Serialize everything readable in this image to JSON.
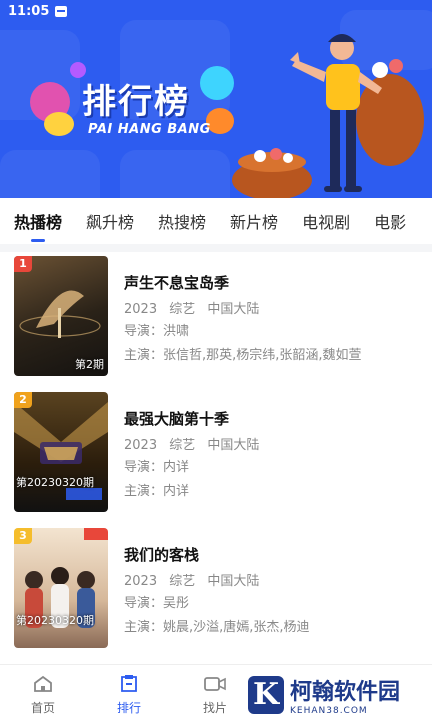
{
  "status_bar": {
    "time": "11:05"
  },
  "banner": {
    "title": "排行榜",
    "subtitle": "PAI HANG BANG",
    "background_color": "#2d5cf0"
  },
  "tabs": [
    {
      "label": "热播榜",
      "active": true
    },
    {
      "label": "飙升榜",
      "active": false
    },
    {
      "label": "热搜榜",
      "active": false
    },
    {
      "label": "新片榜",
      "active": false
    },
    {
      "label": "电视剧",
      "active": false
    },
    {
      "label": "电影",
      "active": false
    }
  ],
  "items": [
    {
      "rank": "1",
      "rank_color": "#e8473a",
      "episode": "第2期",
      "title": "声生不息宝岛季",
      "year": "2023",
      "genre": "综艺",
      "region": "中国大陆",
      "director_label": "导演：",
      "director": "洪啸",
      "cast_label": "主演：",
      "cast": "张信哲,那英,杨宗纬,张韶涵,魏如萱"
    },
    {
      "rank": "2",
      "rank_color": "#f0a21c",
      "episode": "第20230320期",
      "title": "最强大脑第十季",
      "year": "2023",
      "genre": "综艺",
      "region": "中国大陆",
      "director_label": "导演：",
      "director": "内详",
      "cast_label": "主演：",
      "cast": "内详"
    },
    {
      "rank": "3",
      "rank_color": "#f5bd2c",
      "episode": "第20230320期",
      "title": "我们的客栈",
      "year": "2023",
      "genre": "综艺",
      "region": "中国大陆",
      "director_label": "导演：",
      "director": "吴彤",
      "cast_label": "主演：",
      "cast": "姚晨,沙溢,唐嫣,张杰,杨迪"
    }
  ],
  "bottom_nav": [
    {
      "label": "首页",
      "icon": "home-icon",
      "active": false
    },
    {
      "label": "排行",
      "icon": "ranking-icon",
      "active": true
    },
    {
      "label": "找片",
      "icon": "video-icon",
      "active": false
    }
  ],
  "watermark": {
    "logo_letter": "K",
    "main": "柯翰软件园",
    "sub": "KEHAN38.COM"
  },
  "accent_color": "#2d5cf0"
}
